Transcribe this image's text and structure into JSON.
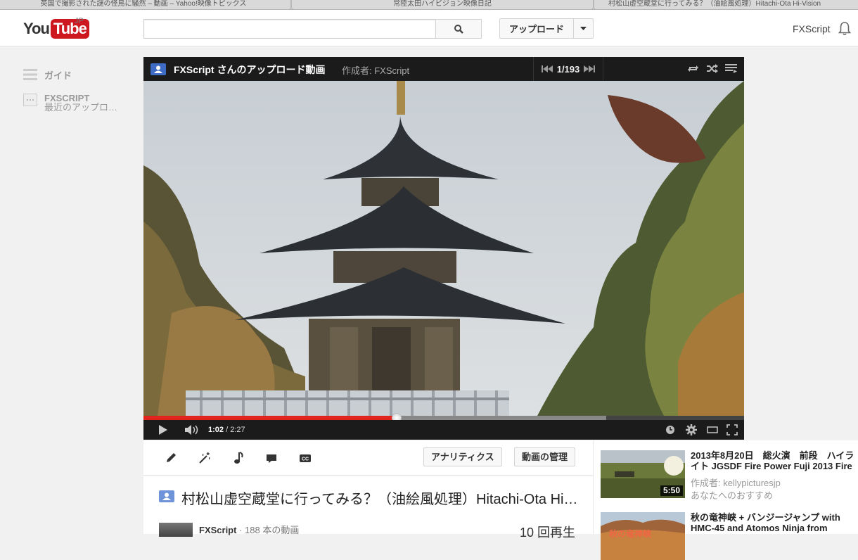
{
  "browser_tabs": [
    "英国で撮影された謎の怪鳥に騒然 – 動画 – Yahoo!映像トピックス",
    "常陸太田ハイビジョン映像日記",
    "村松山虚空蔵堂に行ってみる？（油絵風処理）Hitachi-Ota Hi-Vision"
  ],
  "header": {
    "logo_you": "You",
    "logo_tube": "Tube",
    "logo_region": "JP",
    "search_placeholder": "",
    "upload_label": "アップロード",
    "user_name": "FXScript"
  },
  "guide": {
    "guide_label": "ガイド",
    "channel_label": "FXSCRIPT",
    "channel_sub": "最近のアップロ…"
  },
  "playlist": {
    "title": "FXScript さんのアップロード動画",
    "author": "作成者: FXScript",
    "position": "1/193"
  },
  "player": {
    "current_time": "1:02",
    "duration": " / 2:27",
    "progress_fraction": 0.4218,
    "buffered_fraction": 0.77
  },
  "owner_actions": {
    "analytics_label": "アナリティクス",
    "manage_label": "動画の管理"
  },
  "video_info": {
    "title": "村松山虚空蔵堂に行ってみる？（油絵風処理）Hitachi-Ota Hi-Vision",
    "channel_name": "FXScript",
    "video_count": " · 188 本の動画",
    "views": "10 回再生"
  },
  "recommendations": [
    {
      "title_line1": "2013年8月20日　総火演　前段　ハイラ",
      "title_line2": "イト JGSDF Fire Power Fuji 2013 Fire",
      "author": "作成者: kellypicturesjp",
      "reason": "あなたへのおすすめ",
      "duration": "5:50"
    },
    {
      "title_line1": "秋の竜神峡 + バンジージャンプ with",
      "title_line2": "HMC-45 and Atomos Ninja from",
      "thumb_caption": "秋の竜神峡"
    }
  ],
  "colors": {
    "brand_red": "#cc181e",
    "progress_red": "#e1241c",
    "playlist_icon_blue": "#3e6bc4"
  }
}
